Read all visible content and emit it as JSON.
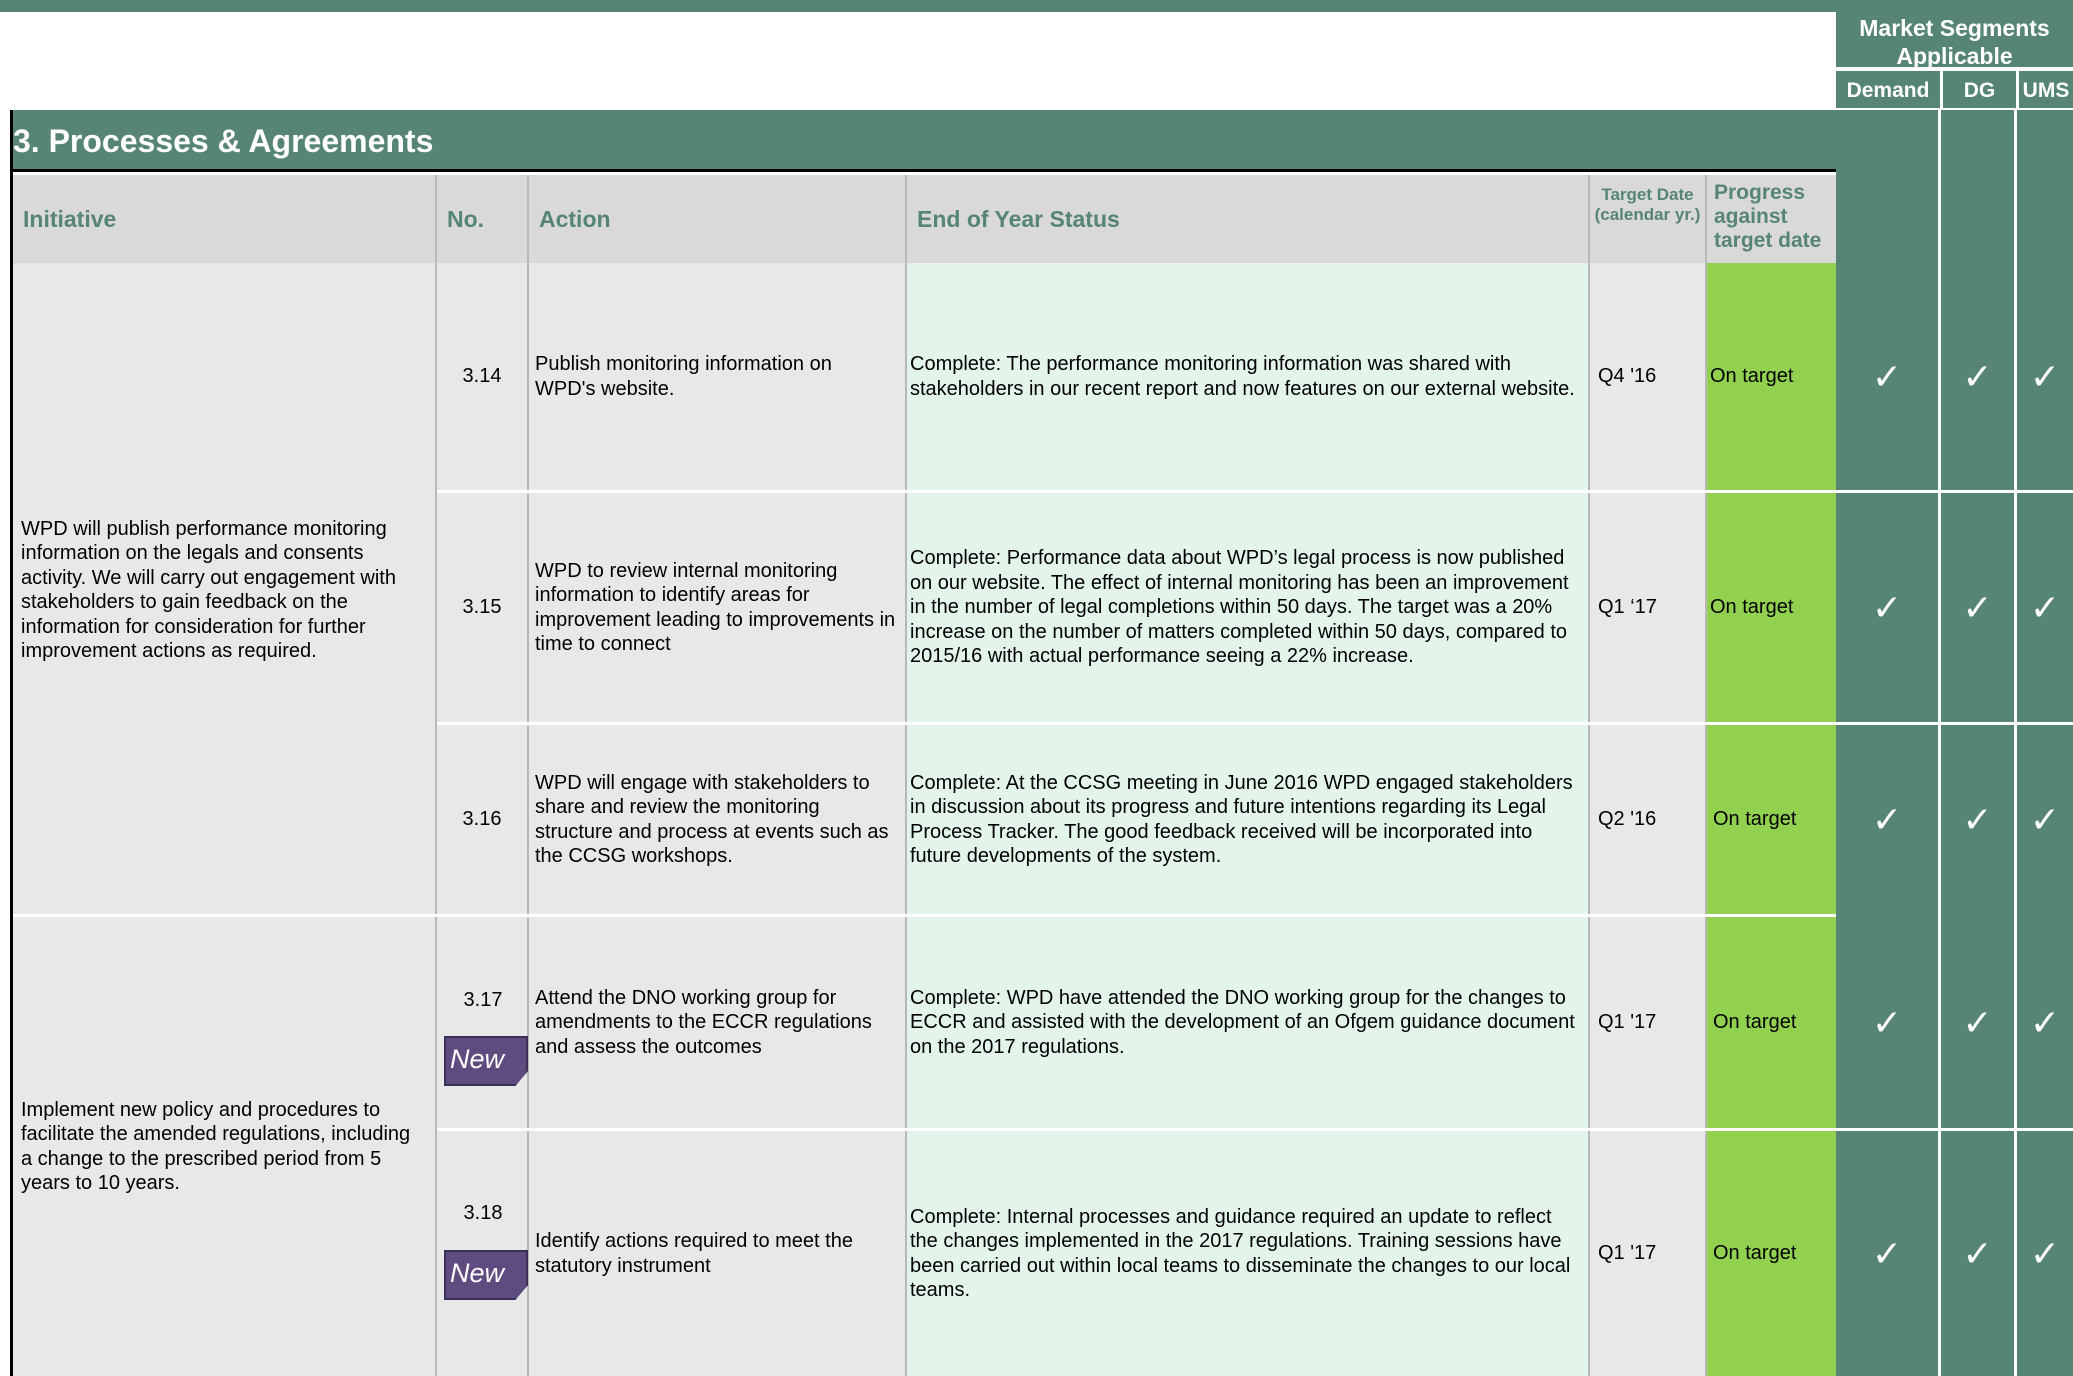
{
  "market_segments": {
    "title": "Market  Segments Applicable",
    "columns": [
      "Demand",
      "DG",
      "UMS"
    ]
  },
  "section": {
    "title": "3. Processes & Agreements"
  },
  "table": {
    "headers": {
      "initiative": "Initiative",
      "no": "No.",
      "action": "Action",
      "status": "End of Year Status",
      "target_date": "Target Date (calendar yr.)",
      "progress": "Progress against target date"
    },
    "groups": [
      {
        "initiative": "WPD will publish performance monitoring information on the legals and consents activity. We will carry out engagement with stakeholders to gain feedback on the information for consideration for further improvement actions as required."
      },
      {
        "initiative": "Implement new policy and procedures to facilitate the amended regulations, including a change to the prescribed period from 5 years to 10 years."
      }
    ],
    "rows": [
      {
        "no": "3.14",
        "new_badge": "",
        "action": "Publish monitoring information on WPD's website.",
        "status": "Complete: The performance monitoring information was shared with stakeholders in our recent report and now features on our external website.",
        "target_date": "Q4 '16",
        "progress": "On target",
        "ticks": [
          "✓",
          "✓",
          "✓"
        ]
      },
      {
        "no": "3.15",
        "new_badge": "",
        "action": "WPD to review internal monitoring information to identify areas for improvement leading to improvements in time to connect",
        "status": "Complete:  Performance data about WPD’s legal process is now published on our website.  The effect of internal monitoring has been an improvement in the number of legal completions within 50 days.  The target was a 20% increase on the number of matters completed within 50 days, compared to 2015/16 with actual performance seeing a 22% increase.",
        "target_date": "Q1 ‘17",
        "progress": "On target",
        "ticks": [
          "✓",
          "✓",
          "✓"
        ]
      },
      {
        "no": "3.16",
        "new_badge": "",
        "action": "WPD will engage with stakeholders to share and review the monitoring structure and process at events such as the CCSG workshops.",
        "status": "Complete: At the CCSG meeting in June 2016 WPD engaged stakeholders in discussion about its progress and future intentions regarding its Legal Process Tracker.  The good feedback received will be incorporated into future developments of the system.",
        "target_date": "Q2 '16",
        "progress": "On target",
        "ticks": [
          "✓",
          "✓",
          "✓"
        ]
      },
      {
        "no": "3.17",
        "new_badge": "New",
        "action": "Attend the DNO working group for amendments to the ECCR regulations and assess the outcomes",
        "status": "Complete: WPD have attended the DNO working group for the changes to ECCR and assisted with the development of an Ofgem guidance document on the 2017 regulations.",
        "target_date": "Q1 '17",
        "progress": "On target",
        "ticks": [
          "✓",
          "✓",
          "✓"
        ]
      },
      {
        "no": "3.18",
        "new_badge": "New",
        "action": "Identify actions  required to meet the statutory instrument",
        "status": "Complete: Internal processes and guidance required an update to reflect the changes implemented in the 2017 regulations.  Training sessions have been carried out within local teams to disseminate the changes to our local teams.",
        "target_date": "Q1 '17",
        "progress": "On target",
        "ticks": [
          "✓",
          "✓",
          "✓"
        ]
      }
    ]
  },
  "colors": {
    "header_green": "#578575",
    "progress_lime": "#92d050",
    "status_mint": "#e3f5ea",
    "cell_gray": "#e8e8e8",
    "badge_purple": "#5e4b80"
  }
}
